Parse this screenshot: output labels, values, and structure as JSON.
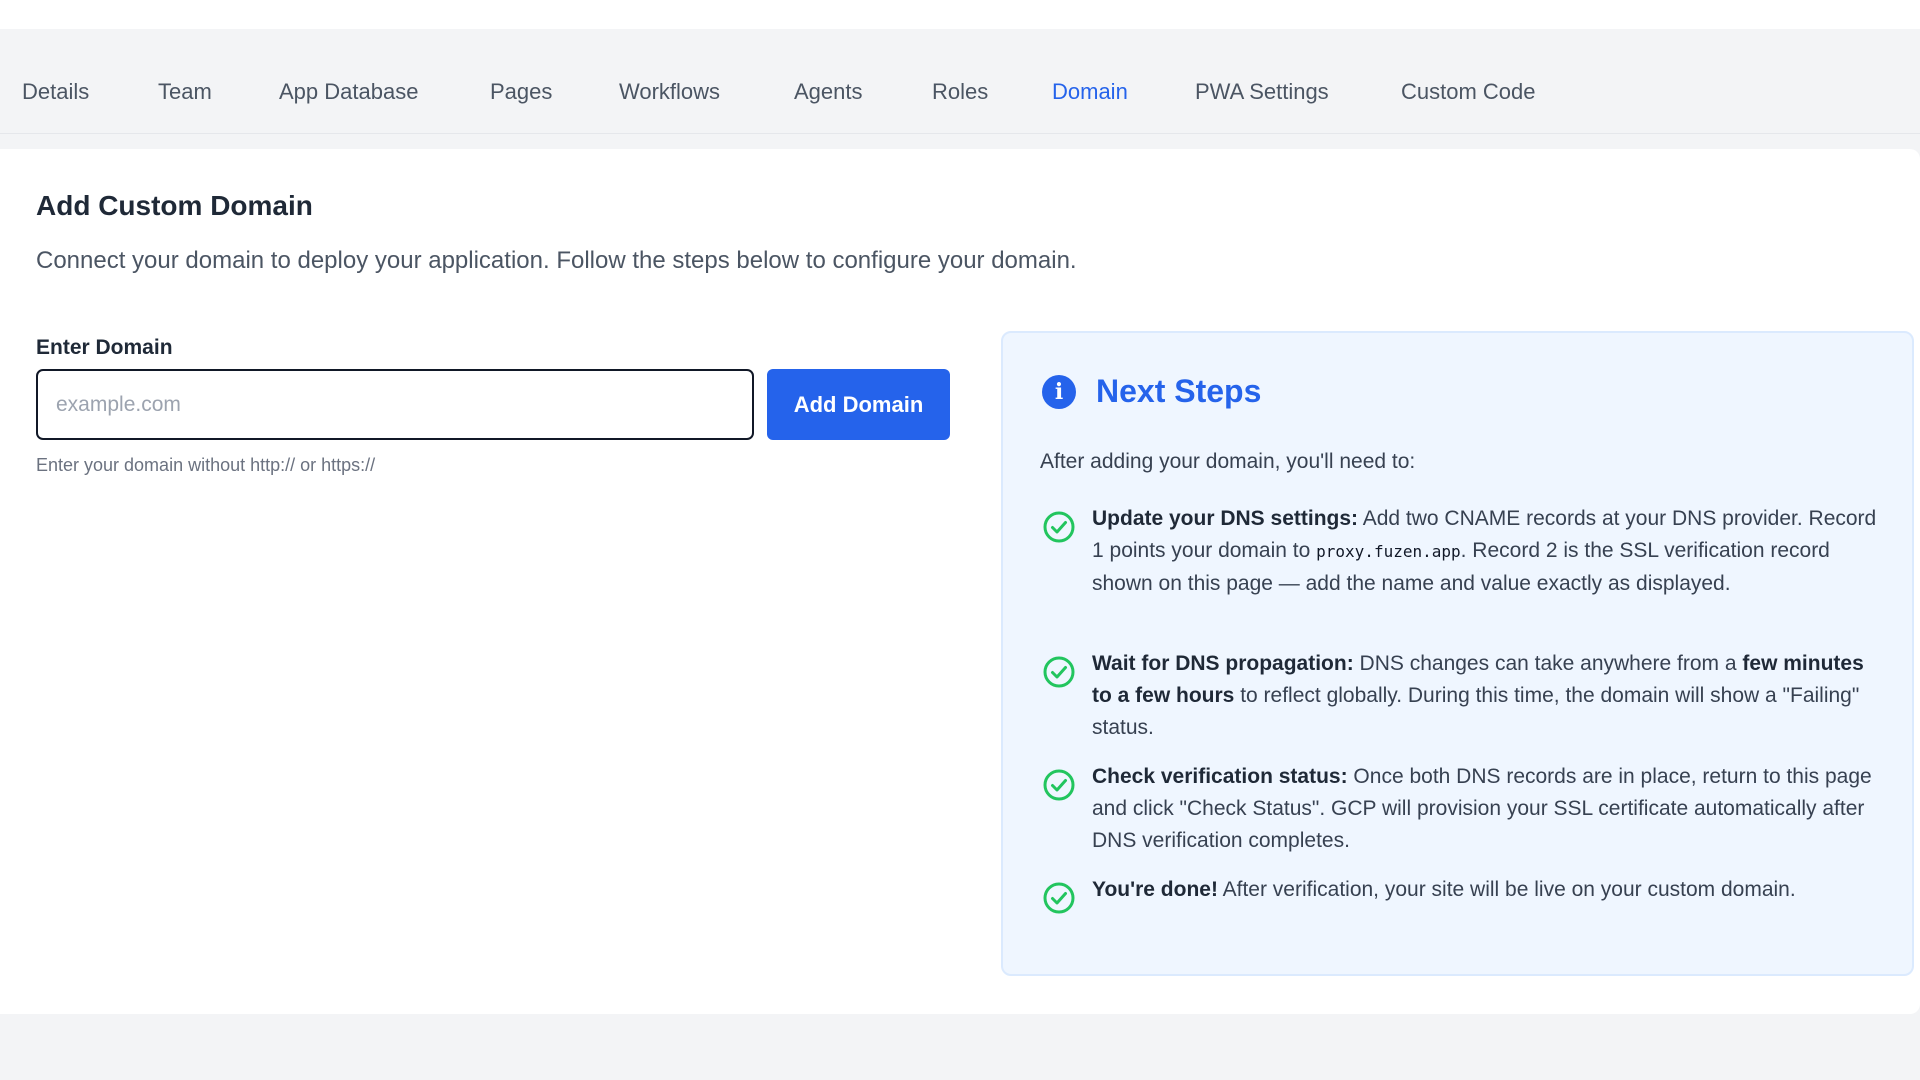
{
  "tabs": [
    {
      "label": "Details",
      "active": false
    },
    {
      "label": "Team",
      "active": false
    },
    {
      "label": "App Database",
      "active": false
    },
    {
      "label": "Pages",
      "active": false
    },
    {
      "label": "Workflows",
      "active": false
    },
    {
      "label": "Agents",
      "active": false
    },
    {
      "label": "Roles",
      "active": false
    },
    {
      "label": "Domain",
      "active": true
    },
    {
      "label": "PWA Settings",
      "active": false
    },
    {
      "label": "Custom Code",
      "active": false
    }
  ],
  "form": {
    "title": "Add Custom Domain",
    "subtitle": "Connect your domain to deploy your application. Follow the steps below to configure your domain.",
    "field_label": "Enter Domain",
    "input_value": "",
    "input_placeholder": "example.com",
    "button_label": "Add Domain",
    "helper_text": "Enter your domain without http:// or https://"
  },
  "next_steps": {
    "title": "Next Steps",
    "intro": "After adding your domain, you'll need to:",
    "steps": [
      {
        "heading": "Update your DNS settings:",
        "text_1": " Add two CNAME records at your DNS provider. Record 1 points your domain to ",
        "code": "proxy.fuzen.app",
        "text_2": ". Record 2 is the SSL verification record shown on this page — add the name and value exactly as displayed."
      },
      {
        "heading": "Wait for DNS propagation:",
        "text_1": " DNS changes can take anywhere from a ",
        "emphasis": "few minutes to a few hours",
        "text_2": " to reflect globally. During this time, the domain will show a \"Failing\" status."
      },
      {
        "heading": "Check verification status:",
        "text_1": " Once both DNS records are in place, return to this page and click \"Check Status\". GCP will provision your SSL certificate automatically after DNS verification completes."
      },
      {
        "heading": "You're done!",
        "text_1": " After verification, your site will be live on your custom domain."
      }
    ]
  },
  "colors": {
    "accent": "#2563eb",
    "success": "#22c55e",
    "info_bg": "#eff6ff"
  },
  "icons": {
    "info": "info-icon",
    "check": "check-circle-icon"
  }
}
